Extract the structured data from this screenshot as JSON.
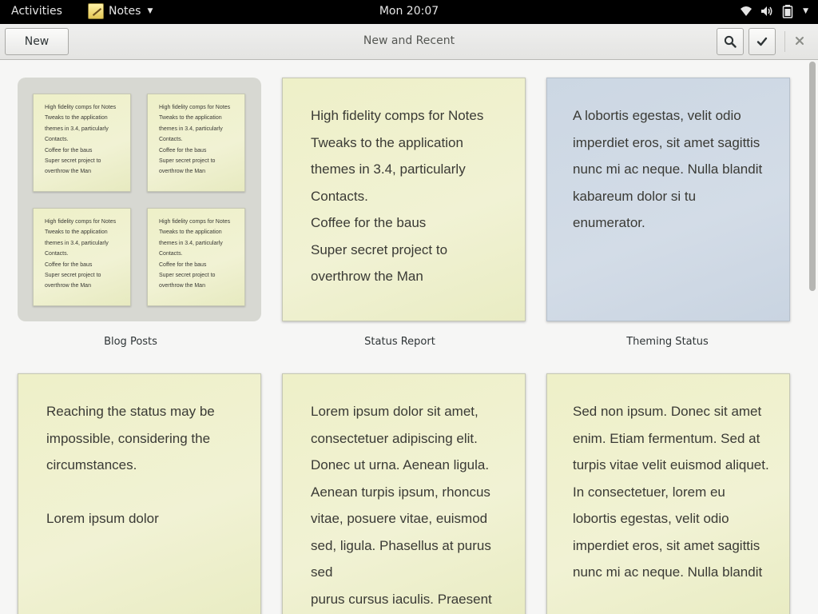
{
  "topbar": {
    "activities": "Activities",
    "app_name": "Notes",
    "clock": "Mon 20:07"
  },
  "headerbar": {
    "new_label": "New",
    "title": "New and Recent"
  },
  "collection": {
    "label": "Blog Posts",
    "mini_text": "High fidelity comps for Notes\nTweaks to the application\nthemes in 3.4, particularly\nContacts.\nCoffee for the baus\nSuper secret project to\noverthrow the Man"
  },
  "notes": [
    {
      "label": "Status Report",
      "text": "High fidelity comps for Notes\nTweaks to the application\nthemes in 3.4, particularly\nContacts.\nCoffee for the baus\nSuper secret project to\noverthrow the Man",
      "color": "#eef0c8"
    },
    {
      "label": "Theming Status",
      "text": "A lobortis egestas, velit odio\nimperdiet eros, sit amet sagittis\nnunc mi ac neque. Nulla blandit\nkabareum dolor si tu\nenumerator.",
      "color": "#ccd7e3"
    },
    {
      "text": "Reaching the status may be\nimpossible, considering the\ncircumstances.\n\nLorem ipsum dolor",
      "color": "#eef0c8"
    },
    {
      "text": "Lorem ipsum dolor sit amet,\nconsectetuer adipiscing elit.\nDonec ut urna. Aenean ligula.\nAenean turpis ipsum, rhoncus\nvitae, posuere vitae, euismod\nsed, ligula. Phasellus at purus sed\npurus cursus iaculis. Praesent",
      "color": "#eef0c8"
    },
    {
      "text": "Sed non ipsum. Donec sit amet\nenim. Etiam fermentum. Sed at\nturpis vitae velit euismod aliquet.\nIn consectetuer, lorem eu\nlobortis egestas, velit odio\nimperdiet eros, sit amet sagittis\nnunc mi ac neque. Nulla blandit",
      "color": "#eef0c8"
    }
  ],
  "icons": {
    "wifi": "wifi-icon",
    "volume": "volume-icon",
    "battery": "battery-icon",
    "search": "search-icon",
    "select": "checkmark-icon",
    "close": "close-icon"
  }
}
